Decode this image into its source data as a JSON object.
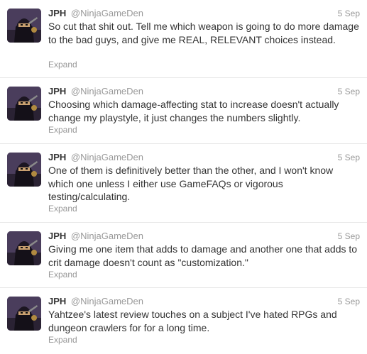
{
  "colors": {
    "name": "#333333",
    "meta": "#999999",
    "divider": "#e8e8e8",
    "avatar_bg": "#3b2f4a"
  },
  "icons": {
    "avatar": "ninja-avatar-icon"
  },
  "tweets": [
    {
      "name": "JPH",
      "handle": "@NinjaGameDen",
      "time": "5 Sep",
      "text": "So cut that shit out. Tell me which weapon is going to do more damage to the bad guys, and give me REAL, RELEVANT choices instead.",
      "expand": "Expand"
    },
    {
      "name": "JPH",
      "handle": "@NinjaGameDen",
      "time": "5 Sep",
      "text": "Choosing which damage-affecting stat to increase doesn't actually change my playstyle, it just changes the numbers slightly.",
      "expand": "Expand"
    },
    {
      "name": "JPH",
      "handle": "@NinjaGameDen",
      "time": "5 Sep",
      "text": "One of them is definitively better than the other, and I won't know which one unless I either use GameFAQs or vigorous testing/calculating.",
      "expand": "Expand"
    },
    {
      "name": "JPH",
      "handle": "@NinjaGameDen",
      "time": "5 Sep",
      "text": "Giving me one item that adds to damage and another one that adds to crit damage doesn't count as \"customization.\"",
      "expand": "Expand"
    },
    {
      "name": "JPH",
      "handle": "@NinjaGameDen",
      "time": "5 Sep",
      "text": "Yahtzee's latest review touches on a subject I've hated RPGs and dungeon crawlers for for a long time.",
      "expand": "Expand"
    }
  ]
}
